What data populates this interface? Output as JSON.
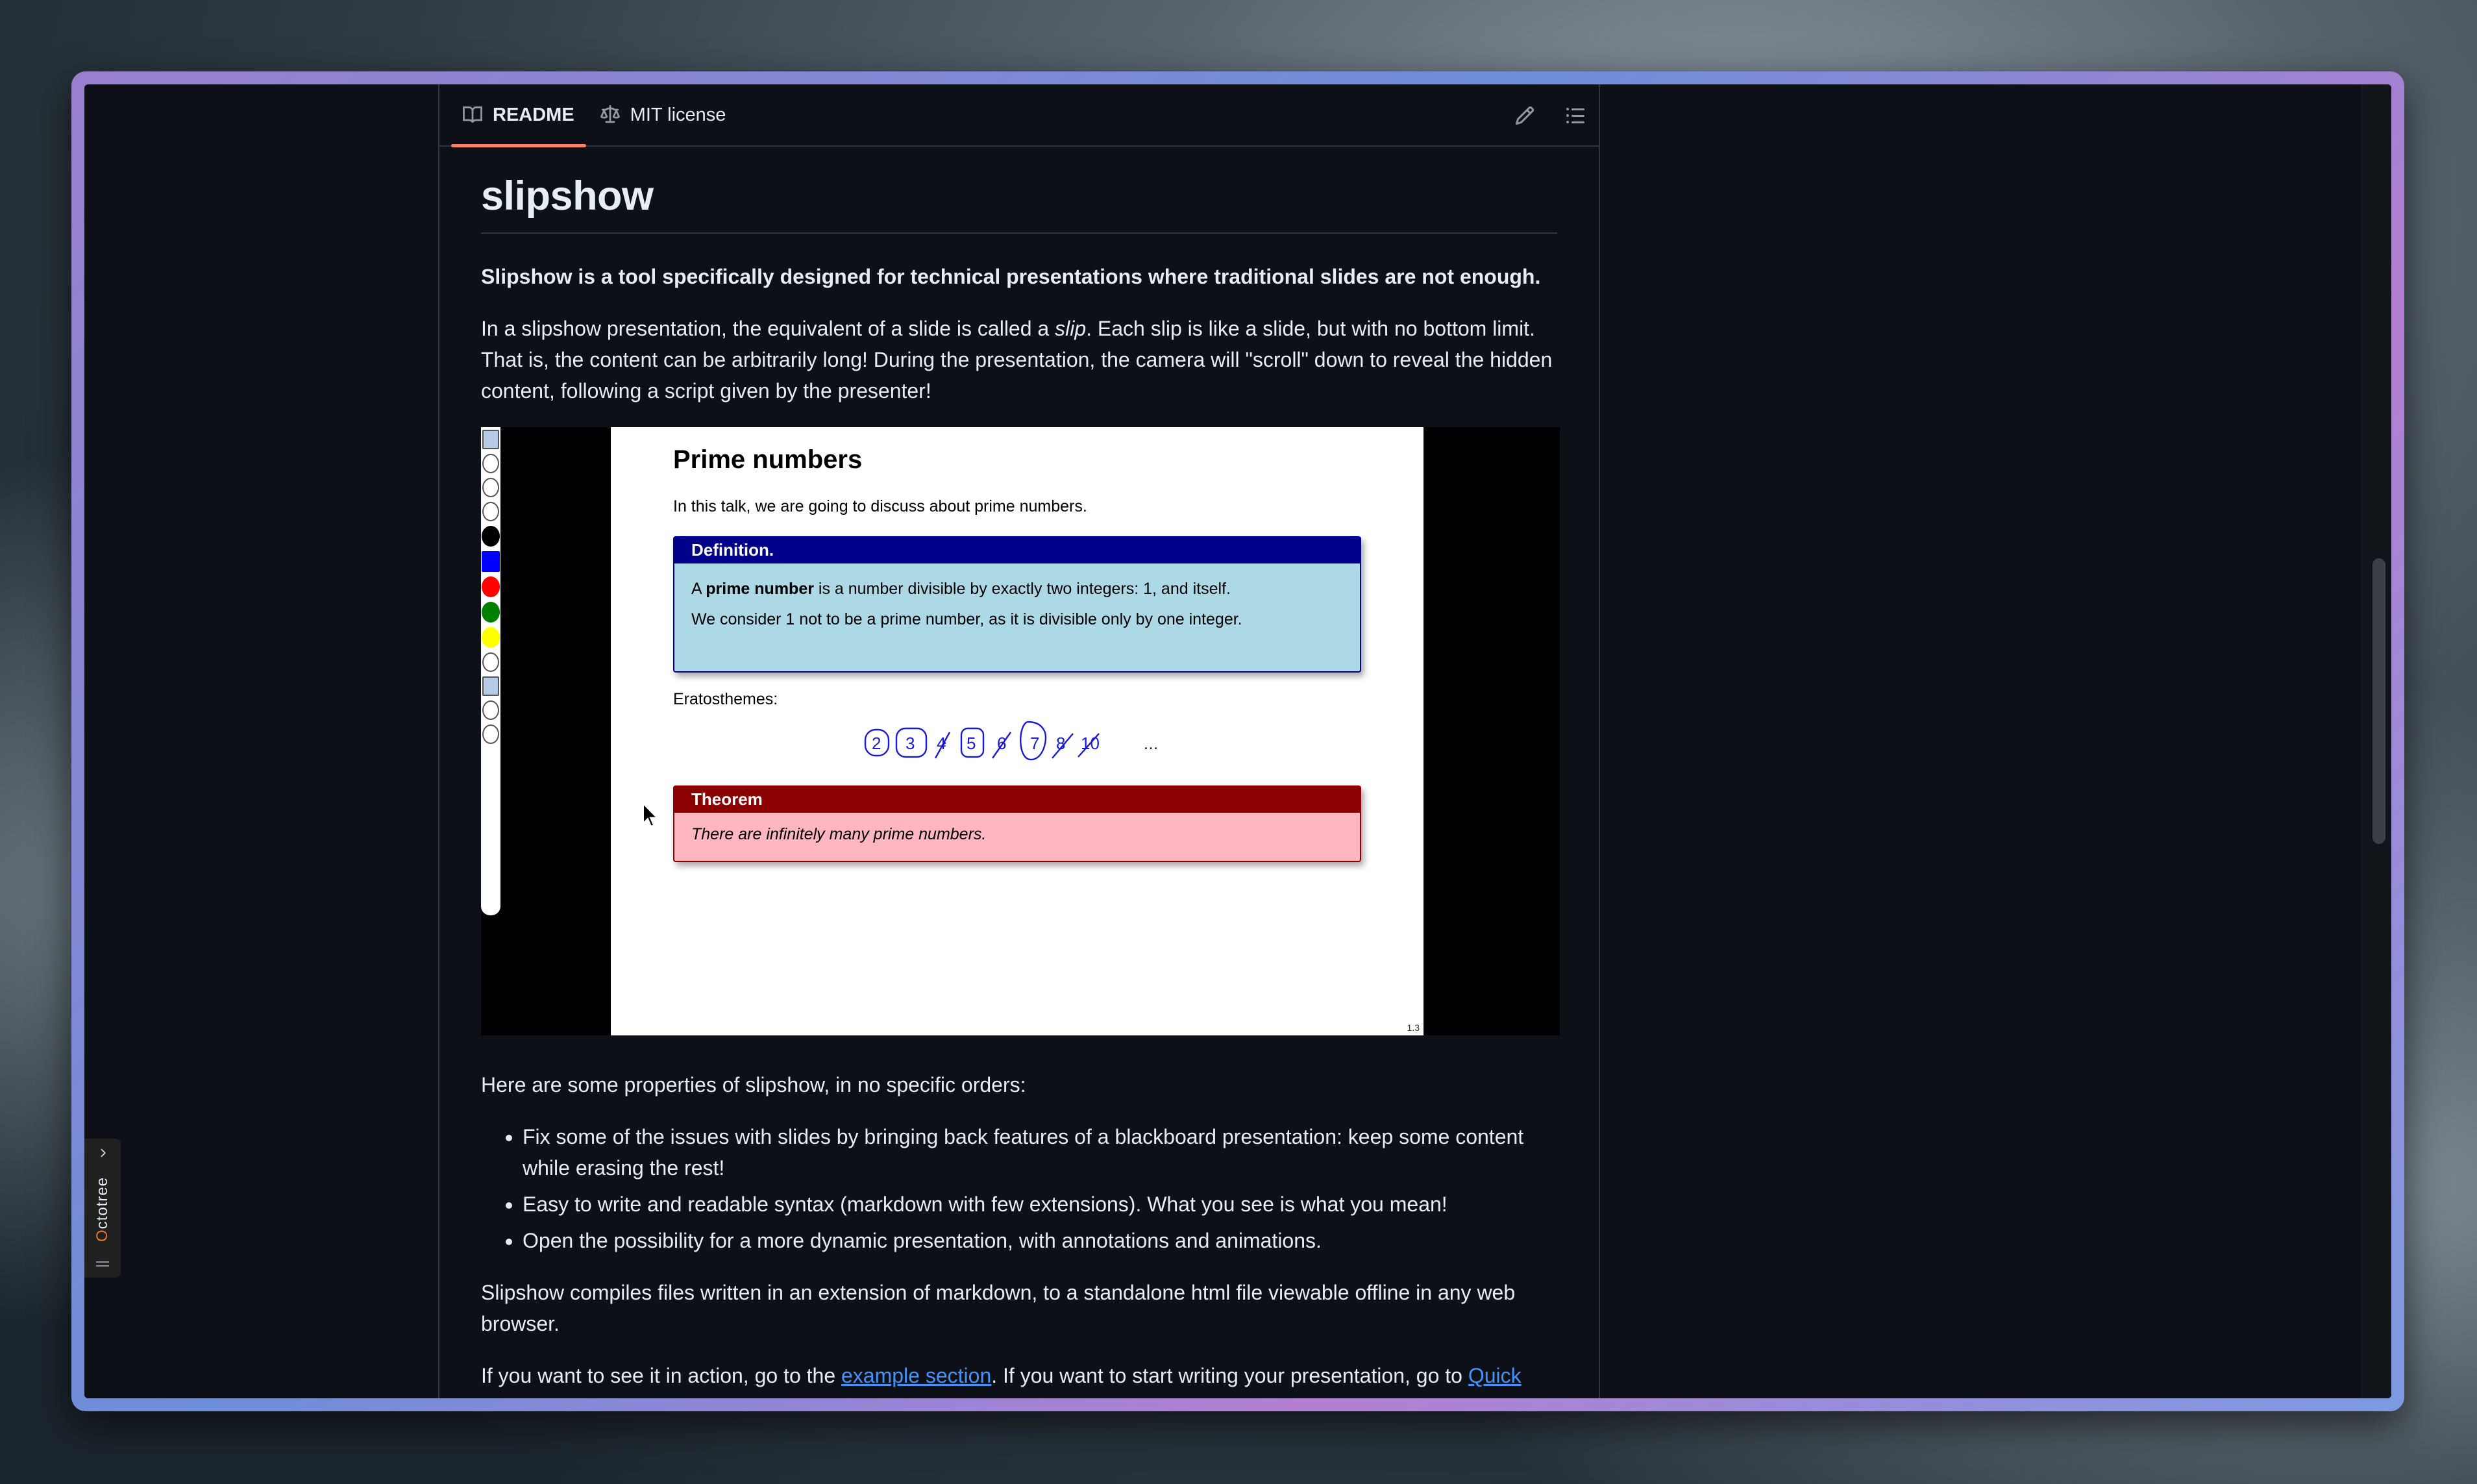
{
  "readme": {
    "tabs": [
      {
        "label": "README",
        "icon": "book-icon",
        "active": true
      },
      {
        "label": "MIT license",
        "icon": "law-icon",
        "active": false
      }
    ],
    "actions": [
      "edit-pencil-icon",
      "outline-list-icon"
    ],
    "title": "slipshow",
    "lead": "Slipshow is a tool specifically designed for technical presentations where traditional slides are not enough.",
    "intro_parts": {
      "a": "In a slipshow presentation, the equivalent of a slide is called a ",
      "em": "slip",
      "b": ". Each slip is like a slide, but with no bottom limit. That is, the content can be arbitrarily long! During the presentation, the camera will \"scroll\" down to reveal the hidden content, following a script given by the presenter!"
    },
    "demo": {
      "slide_title": "Prime numbers",
      "slide_intro": "In this talk, we are going to discuss about prime numbers.",
      "definition_header": "Definition.",
      "definition_line1_pre": "A ",
      "definition_line1_bold": "prime number",
      "definition_line1_post": " is a number divisible by exactly two integers: 1, and itself.",
      "definition_line2": "We consider 1 not to be a prime number, as it is divisible only by one integer.",
      "erat_label": "Eratosthemes:",
      "theorem_header": "Theorem",
      "theorem_body": "There are infinitely many prime numbers.",
      "slide_number": "1.3",
      "toolbar_colors": [
        "#000000",
        "#0000ff",
        "#ff0000",
        "#008000",
        "#ffff00"
      ]
    },
    "properties_intro": "Here are some properties of slipshow, in no specific orders:",
    "properties": [
      "Fix some of the issues with slides by bringing back features of a blackboard presentation: keep some content while erasing the rest!",
      "Easy to write and readable syntax (markdown with few extensions). What you see is what you mean!",
      "Open the possibility for a more dynamic presentation, with annotations and animations."
    ],
    "compiles": "Slipshow compiles files written in an extension of markdown, to a standalone html file viewable offline in any web browser.",
    "action_parts": {
      "a": "If you want to see it in action, go to the ",
      "link1": "example section",
      "b": ". If you want to start writing your presentation, go to ",
      "link2": "Quick"
    }
  },
  "octotree": {
    "label_first": "O",
    "label_rest": "ctotree"
  },
  "colors": {
    "accent_tab": "#f78166",
    "link": "#4493f8",
    "bg": "#0d1117"
  }
}
